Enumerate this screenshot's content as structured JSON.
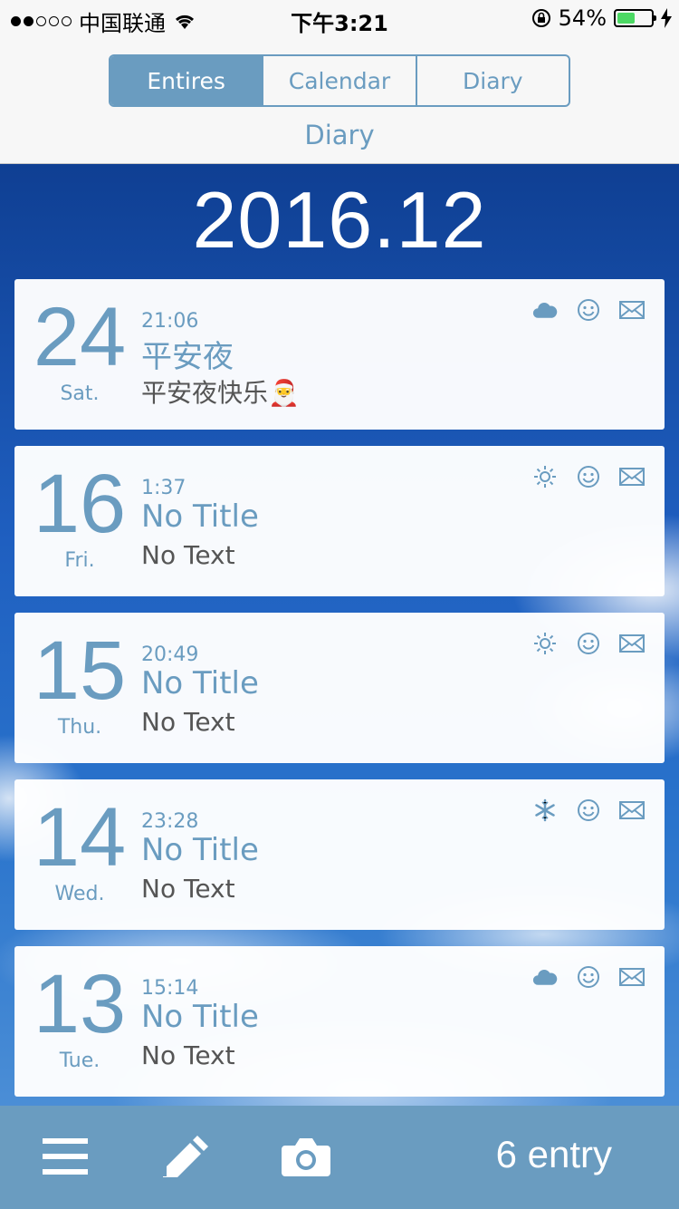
{
  "status": {
    "carrier": "中国联通",
    "time": "下午3:21",
    "battery": "54%",
    "battery_level": 0.54
  },
  "segments": [
    {
      "label": "Entires",
      "active": true
    },
    {
      "label": "Calendar",
      "active": false
    },
    {
      "label": "Diary",
      "active": false
    }
  ],
  "nav": {
    "title": "Diary"
  },
  "month": "2016.12",
  "entries": [
    {
      "day": "24",
      "weekday": "Sat.",
      "time": "21:06",
      "title": "平安夜",
      "text": "平安夜快乐🎅",
      "weather_icon": "cloud-icon"
    },
    {
      "day": "16",
      "weekday": "Fri.",
      "time": "1:37",
      "title": "No Title",
      "text": "No Text",
      "weather_icon": "sun-icon"
    },
    {
      "day": "15",
      "weekday": "Thu.",
      "time": "20:49",
      "title": "No Title",
      "text": "No Text",
      "weather_icon": "sun-icon"
    },
    {
      "day": "14",
      "weekday": "Wed.",
      "time": "23:28",
      "title": "No Title",
      "text": "No Text",
      "weather_icon": "snow-icon"
    },
    {
      "day": "13",
      "weekday": "Tue.",
      "time": "15:14",
      "title": "No Title",
      "text": "No Text",
      "weather_icon": "cloud-icon"
    }
  ],
  "toolbar": {
    "count": "6 entry"
  },
  "colors": {
    "accent": "#6a9cc0",
    "battery": "#4cd964"
  }
}
